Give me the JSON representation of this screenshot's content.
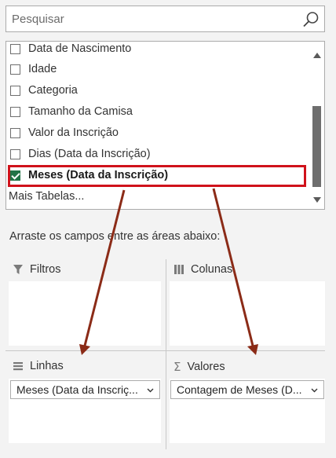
{
  "search": {
    "placeholder": "Pesquisar"
  },
  "fields": {
    "items": [
      {
        "label": "Data de Nascimento",
        "checked": false
      },
      {
        "label": "Idade",
        "checked": false
      },
      {
        "label": "Categoria",
        "checked": false
      },
      {
        "label": "Tamanho da Camisa",
        "checked": false
      },
      {
        "label": "Valor da Inscrição",
        "checked": false
      },
      {
        "label": "Dias (Data da Inscrição)",
        "checked": false
      },
      {
        "label": "Meses (Data da Inscrição)",
        "checked": true
      }
    ],
    "more_tables": "Mais Tabelas..."
  },
  "instruction": "Arraste os campos entre as áreas abaixo:",
  "areas": {
    "filters": {
      "title": "Filtros",
      "icon": "filter-icon"
    },
    "columns": {
      "title": "Colunas",
      "icon": "columns-icon"
    },
    "rows": {
      "title": "Linhas",
      "icon": "rows-icon",
      "item": "Meses (Data da Inscriç..."
    },
    "values": {
      "title": "Valores",
      "icon": "sigma-icon",
      "item": "Contagem de Meses (D..."
    }
  },
  "colors": {
    "highlight": "#d0121b",
    "check": "#217346",
    "arrow": "#8b2b17"
  }
}
